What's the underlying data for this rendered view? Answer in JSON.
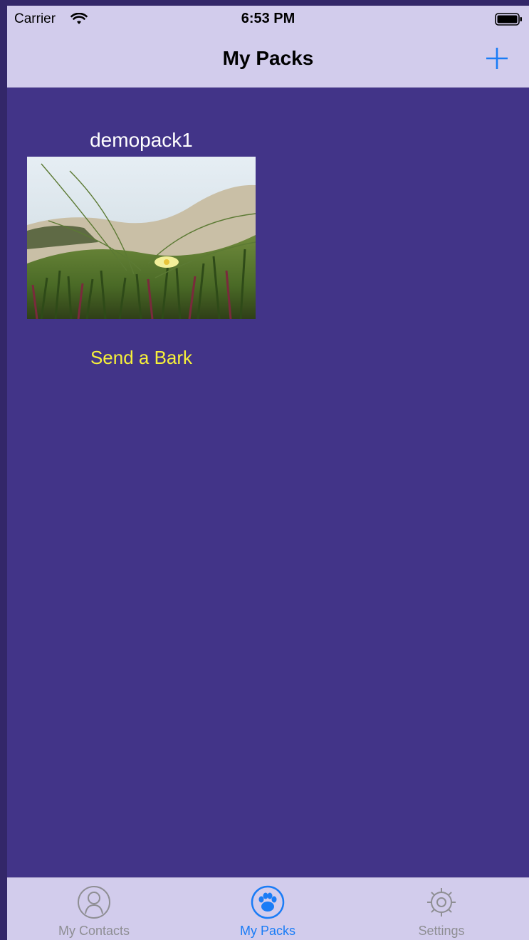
{
  "status_bar": {
    "carrier": "Carrier",
    "time": "6:53 PM",
    "wifi_icon": "wifi-icon",
    "battery_icon": "battery-icon"
  },
  "nav": {
    "title": "My Packs",
    "add_icon": "plus-icon",
    "accent": "#1a7cf6"
  },
  "packs": [
    {
      "name": "demopack1",
      "image": "dune-flower-photo",
      "action_label": "Send a Bark",
      "action_color": "#f6f03a"
    }
  ],
  "tabs": [
    {
      "label": "My Contacts",
      "icon": "person-icon",
      "active": false
    },
    {
      "label": "My Packs",
      "icon": "paw-icon",
      "active": true
    },
    {
      "label": "Settings",
      "icon": "gear-icon",
      "active": false
    }
  ]
}
